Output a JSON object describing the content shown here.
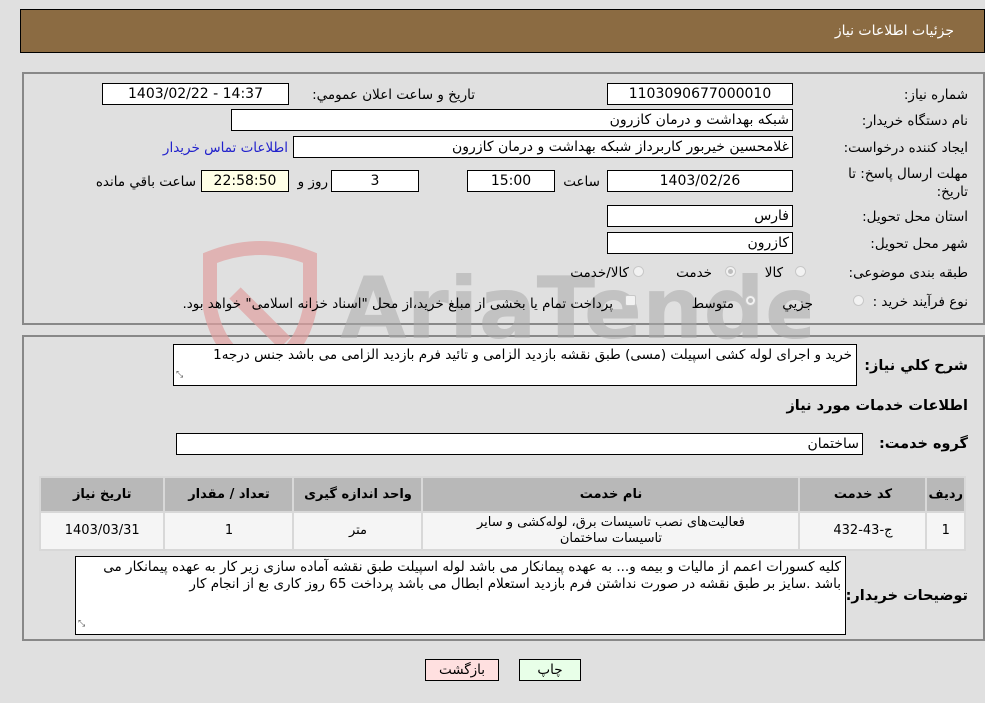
{
  "header": {
    "title": "جزئیات اطلاعات نیاز"
  },
  "details": {
    "need_number": {
      "label": "شماره نیاز:",
      "value": "1103090677000010"
    },
    "announce": {
      "label": "تاریخ و ساعت اعلان عمومي:",
      "value": "1403/02/22 - 14:37"
    },
    "buyer_org": {
      "label": "نام دستگاه خریدار:",
      "value": "شبکه بهداشت و درمان کازرون"
    },
    "creator": {
      "label": "ایجاد کننده درخواست:",
      "value": "غلامحسین  خیربور  کاربرداز شبکه بهداشت و درمان کازرون"
    },
    "contact_link": "اطلاعات تماس خریدار",
    "deadline": {
      "label": "مهلت ارسال پاسخ: تا تاریخ:",
      "date": "1403/02/26",
      "time_label": "ساعت",
      "time": "15:00",
      "days": "3",
      "days_label": "روز و",
      "remaining": "22:58:50",
      "remaining_label": "ساعت باقي مانده"
    },
    "province": {
      "label": "استان محل تحویل:",
      "value": "فارس"
    },
    "city": {
      "label": "شهر محل تحویل:",
      "value": "کازرون"
    },
    "category": {
      "label": "طبقه بندی موضوعی:",
      "options": [
        "کالا",
        "خدمت",
        "کالا/خدمت"
      ],
      "selected": "خدمت"
    },
    "process": {
      "label": "نوع فرآیند خرید :",
      "options": [
        "جزيي",
        "متوسط"
      ],
      "selected": "متوسط",
      "treasury_note": "پرداخت تمام یا بخشی از مبلغ خرید،از محل \"اسناد خزانه اسلامی\" خواهد بود."
    }
  },
  "description": {
    "label": "شرح کلي نیاز:",
    "value": "خرید و اجرای لوله کشی اسپیلت (مسی) طبق نقشه بازدید الزامی و تائید فرم بازدید الزامی می باشد جنس درجه1"
  },
  "services": {
    "section_title": "اطلاعات خدمات مورد نیاز",
    "group_label": "گروه خدمت:",
    "group_value": "ساختمان",
    "columns": [
      "ردیف",
      "کد خدمت",
      "نام خدمت",
      "واحد اندازه گیری",
      "تعداد / مقدار",
      "تاریخ نیاز"
    ],
    "rows": [
      [
        "1",
        "ج-43-432",
        "فعالیت‌های نصب تاسیسات برق، لوله‌کشی و سایر تاسیسات ساختمان",
        "متر",
        "1",
        "1403/03/31"
      ]
    ]
  },
  "buyer_notes": {
    "label": "توضیحات خریدار:",
    "value": "کلیه کسورات اعمم از مالیات و بیمه و... به عهده پیمانکار می باشد لوله اسپیلت طبق نقشه آماده سازی زیر کار به عهده پیمانکار می باشد .سایز بر طبق نقشه در صورت نداشتن فرم بازدید استعلام  ابطال می باشد پرداخت 65 روز کاری بع از انجام کار"
  },
  "buttons": {
    "print": "چاپ",
    "back": "بازگشت"
  },
  "watermark": {
    "text": "AriaTender.neT"
  }
}
